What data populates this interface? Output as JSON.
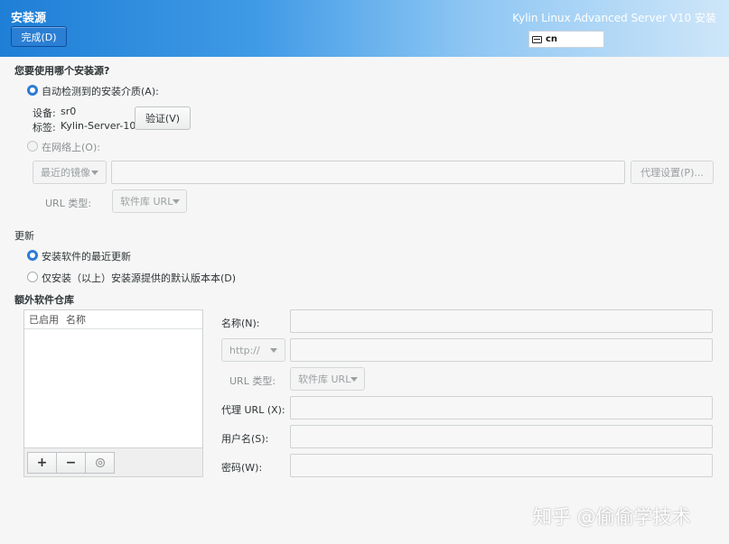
{
  "header": {
    "title": "安装源",
    "done_label": "完成(D)",
    "product": "Kylin Linux Advanced Server V10 安装",
    "keyboard_layout": "cn"
  },
  "source": {
    "question": "您要使用哪个安装源?",
    "auto_label": "自动检测到的安装介质(A):",
    "device_label": "设备:",
    "device_value": "sr0",
    "tag_label": "标签:",
    "tag_value": "Kylin-Server-10",
    "verify_label": "验证(V)",
    "network_label": "在网络上(O):",
    "mirror_combo": "最近的镜像",
    "proxy_label": "代理设置(P)...",
    "url_type_label": "URL 类型:",
    "url_type_value": "软件库 URL"
  },
  "updates": {
    "heading": "更新",
    "option_latest": "安装软件的最近更新",
    "option_default": "仅安装（以上）安装源提供的默认版本本(D)"
  },
  "extra_repos": {
    "heading": "额外软件仓库",
    "col_enabled": "已启用",
    "col_name": "名称",
    "add": "+",
    "remove": "−",
    "form": {
      "name_label": "名称(N):",
      "protocol_value": "http://",
      "url_type_label": "URL 类型:",
      "url_type_value": "软件库 URL",
      "proxy_label": "代理 URL (X):",
      "user_label": "用户名(S):",
      "password_label": "密码(W):"
    }
  },
  "watermark": "知乎 @偷偷学技术"
}
